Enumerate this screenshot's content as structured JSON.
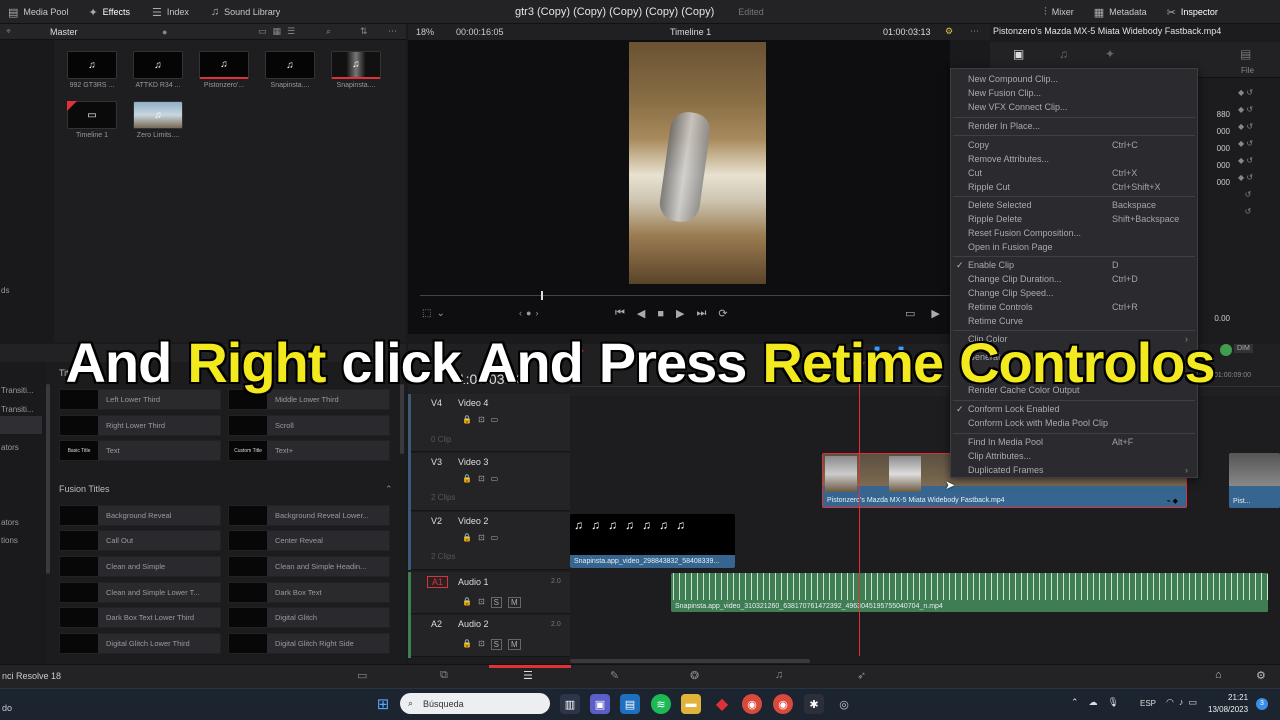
{
  "topbar": {
    "media_pool": "Media Pool",
    "effects": "Effects",
    "index": "Index",
    "sound_library": "Sound Library",
    "project_title": "gtr3 (Copy) (Copy) (Copy) (Copy) (Copy)",
    "edited": "Edited",
    "mixer": "Mixer",
    "metadata": "Metadata",
    "inspector": "Inspector"
  },
  "media_pool": {
    "folder": "Master",
    "clips": [
      "992 GT3RS ...",
      "ATTKD R34 ...",
      "Pistonzero'...",
      "Snapinsta....",
      "Snapinsta....",
      "Timeline 1",
      "Zero Limits...."
    ]
  },
  "viewer": {
    "zoom": "18%",
    "timecode_left": "00:00:16:05",
    "timeline_name": "Timeline 1",
    "timecode_right": "01:00:03:13"
  },
  "inspector": {
    "clip_name": "Pistonzero's Mazda MX-5 Miata Widebody Fastback.mp4",
    "file_tab": "File",
    "values": [
      "880",
      "000",
      "000",
      "000",
      "000",
      "0.00"
    ]
  },
  "effects": {
    "side": [
      "ds",
      "Transiti...",
      "Transiti...",
      "ators",
      "ators",
      "tions"
    ],
    "titles_header": "Titles",
    "titles": [
      "Left Lower Third",
      "Middle Lower Third",
      "Right Lower Third",
      "Scroll",
      "Text",
      "Text+"
    ],
    "title_previews": [
      "Basic Title",
      "Custom Title"
    ],
    "fusion_header": "Fusion Titles",
    "fusion": [
      "Background Reveal",
      "Background Reveal Lower...",
      "Call Out",
      "Center Reveal",
      "Clean and Simple",
      "Clean and Simple Headin...",
      "Clean and Simple Lower T...",
      "Dark Box Text",
      "Dark Box Text Lower Third",
      "Digital Glitch",
      "Digital Glitch Lower Third",
      "Digital Glitch Right Side"
    ]
  },
  "timeline": {
    "timecode": "01:00:03:13",
    "ruler_mark": "01:00:09:00",
    "tracks": [
      {
        "id": "V4",
        "name": "Video 4",
        "clips": "0 Clip"
      },
      {
        "id": "V3",
        "name": "Video 3",
        "clips": "2 Clips"
      },
      {
        "id": "V2",
        "name": "Video 2",
        "clips": "2 Clips"
      },
      {
        "id": "A1",
        "name": "Audio 1",
        "level": "2.0"
      },
      {
        "id": "A2",
        "name": "Audio 2",
        "level": "2.0"
      }
    ],
    "clip_v3": "Pistonzero's Mazda MX-5 Miata Widebody Fastback.mp4",
    "clip_v3_right": "Pist...",
    "clip_v2": "Snapinsta.app_video_298843832_58408339...",
    "clip_a1": "Snapinsta.app_video_310321260_638170761472392_4963045195755040704_n.mp4",
    "mute_label": "M",
    "solo_label": "S"
  },
  "context_menu": {
    "groups": [
      [
        {
          "label": "New Compound Clip...",
          "shortcut": ""
        },
        {
          "label": "New Fusion Clip...",
          "shortcut": ""
        },
        {
          "label": "New VFX Connect Clip...",
          "shortcut": ""
        }
      ],
      [
        {
          "label": "Render In Place...",
          "shortcut": ""
        }
      ],
      [
        {
          "label": "Copy",
          "shortcut": "Ctrl+C"
        },
        {
          "label": "Remove Attributes...",
          "shortcut": ""
        },
        {
          "label": "Cut",
          "shortcut": "Ctrl+X"
        },
        {
          "label": "Ripple Cut",
          "shortcut": "Ctrl+Shift+X"
        }
      ],
      [
        {
          "label": "Delete Selected",
          "shortcut": "Backspace"
        },
        {
          "label": "Ripple Delete",
          "shortcut": "Shift+Backspace"
        },
        {
          "label": "Reset Fusion Composition...",
          "shortcut": ""
        },
        {
          "label": "Open in Fusion Page",
          "shortcut": ""
        }
      ],
      [
        {
          "label": "Enable Clip",
          "shortcut": "D"
        },
        {
          "label": "Change Clip Duration...",
          "shortcut": "Ctrl+D"
        },
        {
          "label": "Change Clip Speed...",
          "shortcut": ""
        },
        {
          "label": "Retime Controls",
          "shortcut": "Ctrl+R"
        },
        {
          "label": "Retime Curve",
          "shortcut": ""
        }
      ],
      [
        {
          "label": "Clip Color",
          "shortcut": ""
        },
        {
          "label": "Generate...",
          "shortcut": ""
        },
        {
          "label": "Render Cache Color Output",
          "shortcut": ""
        }
      ],
      [
        {
          "label": "Conform Lock Enabled",
          "shortcut": ""
        },
        {
          "label": "Conform Lock with Media Pool Clip",
          "shortcut": ""
        }
      ],
      [
        {
          "label": "Find In Media Pool",
          "shortcut": "Alt+F"
        },
        {
          "label": "Clip Attributes...",
          "shortcut": ""
        },
        {
          "label": "Duplicated Frames",
          "shortcut": ""
        }
      ]
    ]
  },
  "caption": {
    "words": [
      {
        "text": "And",
        "color": "#ffffff"
      },
      {
        "text": "Right",
        "color": "#f2ea1f"
      },
      {
        "text": "click",
        "color": "#ffffff"
      },
      {
        "text": "And",
        "color": "#ffffff"
      },
      {
        "text": "Press",
        "color": "#ffffff"
      },
      {
        "text": "Retime",
        "color": "#f2ea1f"
      },
      {
        "text": "Controlos",
        "color": "#f2ea1f"
      }
    ]
  },
  "bottom": {
    "app_name": "nci Resolve 18"
  },
  "taskbar": {
    "search_placeholder": "Búsqueda",
    "lang": "ESP",
    "time": "21:21",
    "date": "13/08/2023",
    "corner": "do"
  },
  "colors": {
    "accent_red": "#e0303a",
    "caption_yellow": "#f2ea1f",
    "clip_blue": "#36668f",
    "audio_green": "#3f7d52"
  }
}
